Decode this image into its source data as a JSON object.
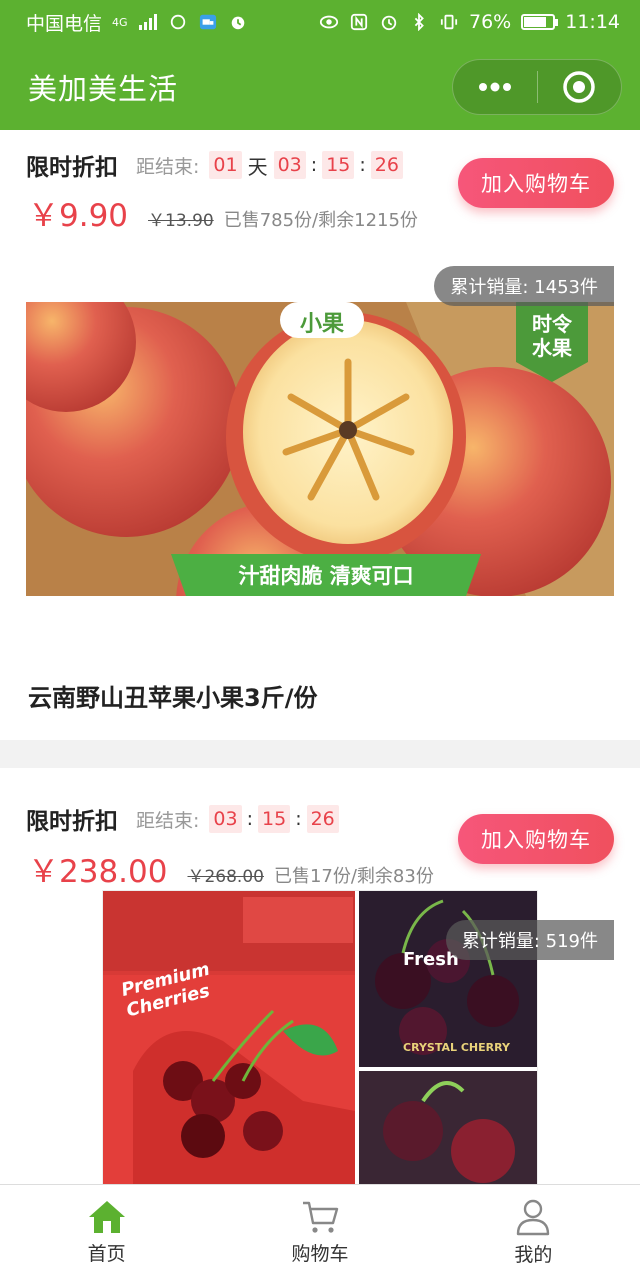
{
  "status_bar": {
    "carrier": "中国电信",
    "network": "4G",
    "battery": "76%",
    "battery_level": 0.76,
    "time": "11:14"
  },
  "nav": {
    "title": "美加美生活",
    "capsule_more_icon": "more-dots-icon",
    "capsule_close_icon": "target-circle-icon"
  },
  "products": [
    {
      "discount_title": "限时折扣",
      "countdown_label": "距结束:",
      "countdown": {
        "days": "01",
        "day_unit": "天",
        "hours": "03",
        "minutes": "15",
        "seconds": "26"
      },
      "price": "￥9.90",
      "old_price": "￥13.90",
      "sold_info": "已售785份/剩余1215份",
      "cart_label": "加入购物车",
      "sales_total": "累计销量: 1453件",
      "image_text": {
        "badge_small": "小果",
        "badge_season_1": "时令",
        "badge_season_2": "水果",
        "banner": "汁甜肉脆 清爽可口"
      },
      "name": "云南野山丑苹果小果3斤/份"
    },
    {
      "discount_title": "限时折扣",
      "countdown_label": "距结束:",
      "countdown": {
        "hours": "03",
        "minutes": "15",
        "seconds": "26"
      },
      "price": "￥238.00",
      "old_price": "￥268.00",
      "sold_info": "已售17份/剩余83份",
      "cart_label": "加入购物车",
      "sales_total": "累计销量: 519件",
      "image_text": {
        "box_line_1": "Premium",
        "box_line_2": "Cherries",
        "brand": "Fresh",
        "crystal": "CRYSTAL CHERRY"
      }
    }
  ],
  "tabbar": {
    "tabs": [
      {
        "label": "首页",
        "icon": "home-icon",
        "active": true
      },
      {
        "label": "购物车",
        "icon": "cart-icon",
        "active": false
      },
      {
        "label": "我的",
        "icon": "user-icon",
        "active": false
      }
    ]
  },
  "colors": {
    "brand_green": "#5cb130",
    "price_red": "#e8424a",
    "button_red": "#f0505e"
  }
}
